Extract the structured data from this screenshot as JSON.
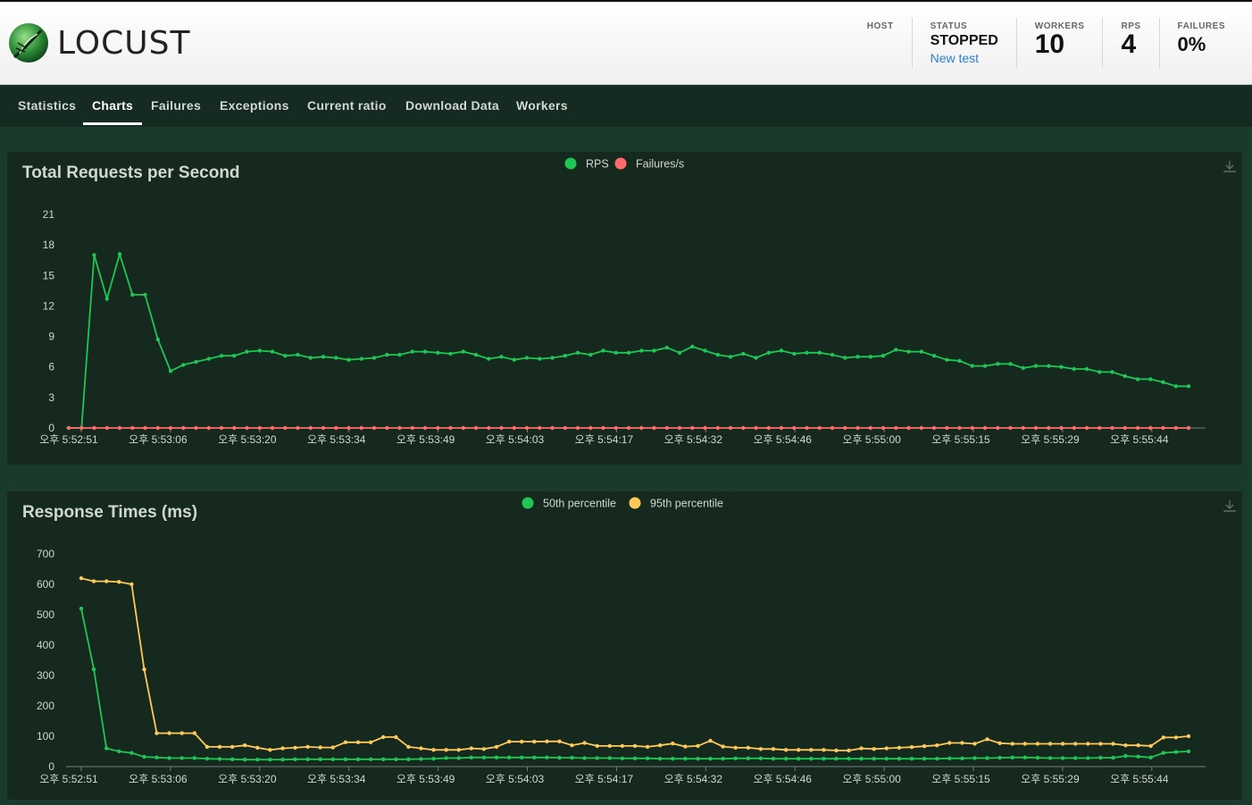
{
  "app": {
    "logo_text": "LOCUST"
  },
  "header": {
    "host_label": "HOST",
    "status_label": "STATUS",
    "status_value": "STOPPED",
    "new_test_label": "New test",
    "workers_label": "WORKERS",
    "workers_value": "10",
    "rps_label": "RPS",
    "rps_value": "4",
    "failures_label": "FAILURES",
    "failures_value": "0%"
  },
  "nav": {
    "tabs": [
      {
        "label": "Statistics"
      },
      {
        "label": "Charts"
      },
      {
        "label": "Failures"
      },
      {
        "label": "Exceptions"
      },
      {
        "label": "Current ratio"
      },
      {
        "label": "Download Data"
      },
      {
        "label": "Workers"
      }
    ],
    "active_tab": "Charts"
  },
  "colors": {
    "green": "#1fc654",
    "red": "#ff6b6b",
    "yellow": "#ffc95a",
    "background": "#1a3a2c",
    "panel": "#15291f"
  },
  "chart_data": [
    {
      "type": "line",
      "title": "Total Requests per Second",
      "ylim": [
        0,
        21
      ],
      "yticks": [
        0,
        3,
        6,
        9,
        12,
        15,
        18,
        21
      ],
      "xtick_labels": [
        "오후 5:52:51",
        "오후 5:53:06",
        "오후 5:53:20",
        "오후 5:53:34",
        "오후 5:53:49",
        "오후 5:54:03",
        "오후 5:54:17",
        "오후 5:54:32",
        "오후 5:54:46",
        "오후 5:55:00",
        "오후 5:55:15",
        "오후 5:55:29",
        "오후 5:55:44"
      ],
      "legend": [
        "RPS",
        "Failures/s"
      ],
      "series": [
        {
          "name": "RPS",
          "color": "#1fc654",
          "values": [
            0,
            0,
            17,
            12.7,
            17.1,
            13.1,
            13.1,
            8.7,
            5.6,
            6.2,
            6.5,
            6.8,
            7.1,
            7.1,
            7.5,
            7.6,
            7.5,
            7.1,
            7.2,
            6.9,
            7,
            6.9,
            6.7,
            6.8,
            6.9,
            7.2,
            7.2,
            7.5,
            7.5,
            7.4,
            7.3,
            7.5,
            7.2,
            6.8,
            7,
            6.7,
            6.9,
            6.8,
            6.9,
            7.1,
            7.4,
            7.2,
            7.6,
            7.4,
            7.4,
            7.6,
            7.6,
            7.9,
            7.4,
            8,
            7.6,
            7.2,
            7,
            7.3,
            6.9,
            7.4,
            7.6,
            7.3,
            7.4,
            7.4,
            7.2,
            6.9,
            7,
            7,
            7.1,
            7.7,
            7.5,
            7.5,
            7.1,
            6.7,
            6.6,
            6.1,
            6.1,
            6.3,
            6.3,
            5.9,
            6.1,
            6.1,
            6,
            5.8,
            5.8,
            5.5,
            5.5,
            5.1,
            4.8,
            4.8,
            4.5,
            4.1,
            4.1
          ]
        },
        {
          "name": "Failures/s",
          "color": "#ff6b6b",
          "values": [
            0,
            0,
            0,
            0,
            0,
            0,
            0,
            0,
            0,
            0,
            0,
            0,
            0,
            0,
            0,
            0,
            0,
            0,
            0,
            0,
            0,
            0,
            0,
            0,
            0,
            0,
            0,
            0,
            0,
            0,
            0,
            0,
            0,
            0,
            0,
            0,
            0,
            0,
            0,
            0,
            0,
            0,
            0,
            0,
            0,
            0,
            0,
            0,
            0,
            0,
            0,
            0,
            0,
            0,
            0,
            0,
            0,
            0,
            0,
            0,
            0,
            0,
            0,
            0,
            0,
            0,
            0,
            0,
            0,
            0,
            0,
            0,
            0,
            0,
            0,
            0,
            0,
            0,
            0,
            0,
            0,
            0,
            0,
            0,
            0,
            0,
            0,
            0,
            0
          ]
        }
      ]
    },
    {
      "type": "line",
      "title": "Response Times (ms)",
      "ylim": [
        0,
        700
      ],
      "yticks": [
        0,
        100,
        200,
        300,
        400,
        500,
        600,
        700
      ],
      "xtick_labels": [
        "오후 5:52:51",
        "오후 5:53:06",
        "오후 5:53:20",
        "오후 5:53:34",
        "오후 5:53:49",
        "오후 5:54:03",
        "오후 5:54:17",
        "오후 5:54:32",
        "오후 5:54:46",
        "오후 5:55:00",
        "오후 5:55:15",
        "오후 5:55:29",
        "오후 5:55:44"
      ],
      "legend": [
        "50th percentile",
        "95th percentile"
      ],
      "series": [
        {
          "name": "50th percentile",
          "color": "#1fc654",
          "values": [
            520,
            320,
            60,
            50,
            45,
            32,
            30,
            28,
            28,
            28,
            26,
            25,
            24,
            23,
            23,
            23,
            23,
            24,
            24,
            24,
            24,
            24,
            24,
            24,
            24,
            24,
            24,
            25,
            26,
            28,
            28,
            30,
            30,
            30,
            30,
            30,
            30,
            30,
            29,
            29,
            28,
            28,
            28,
            27,
            27,
            27,
            26,
            26,
            26,
            26,
            26,
            26,
            27,
            27,
            27,
            26,
            26,
            26,
            26,
            26,
            26,
            26,
            26,
            26,
            26,
            26,
            26,
            26,
            26,
            27,
            27,
            28,
            28,
            29,
            30,
            30,
            29,
            28,
            28,
            28,
            28,
            29,
            29,
            35,
            33,
            30,
            45,
            48,
            50
          ]
        },
        {
          "name": "95th percentile",
          "color": "#ffc95a",
          "values": [
            620,
            610,
            610,
            608,
            600,
            320,
            110,
            110,
            110,
            110,
            65,
            65,
            65,
            70,
            62,
            55,
            60,
            62,
            65,
            63,
            63,
            80,
            80,
            80,
            97,
            97,
            65,
            60,
            55,
            55,
            55,
            60,
            58,
            65,
            82,
            82,
            82,
            83,
            83,
            70,
            78,
            68,
            68,
            68,
            68,
            65,
            70,
            76,
            66,
            68,
            85,
            66,
            62,
            62,
            58,
            58,
            55,
            55,
            55,
            55,
            53,
            53,
            60,
            58,
            60,
            62,
            64,
            67,
            70,
            78,
            78,
            75,
            90,
            77,
            75,
            75,
            75,
            75,
            75,
            75,
            75,
            75,
            75,
            70,
            70,
            68,
            96,
            96,
            100
          ]
        }
      ]
    }
  ]
}
